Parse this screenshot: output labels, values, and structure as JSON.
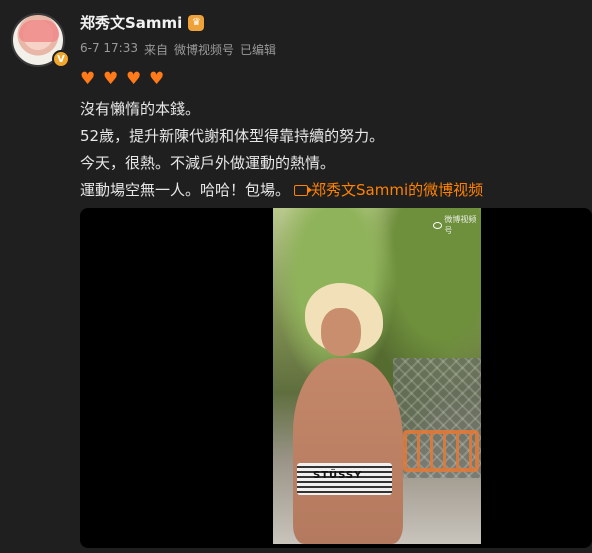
{
  "user": {
    "name": "郑秀文Sammi",
    "crown_icon": "crown-badge-icon",
    "verified_icon": "verified-v-icon",
    "verified_mark": "V"
  },
  "meta": {
    "time": "6-7 17:33",
    "source_prefix": "来自",
    "source": "微博视频号",
    "edited": "已编辑"
  },
  "hearts": [
    "♥",
    "♥",
    "♥",
    "♥"
  ],
  "post_lines": [
    "沒有懶惰的本錢。",
    "52歲，提升新陳代謝和体型得靠持續的努力。",
    "今天，很熱。不減戶外做運動的熱情。",
    "運動場空無一人。哈哈！包場。"
  ],
  "video_link": {
    "label": "郑秀文Sammi的微博视频",
    "icon": "video-camera-icon"
  },
  "video": {
    "watermark": "微博视频号",
    "shirt_brand": "STÜSSY"
  },
  "colors": {
    "background": "#1f1f1f",
    "link": "#ff8200",
    "heart": "#ff7a1a",
    "meta": "#9a9a9a"
  }
}
